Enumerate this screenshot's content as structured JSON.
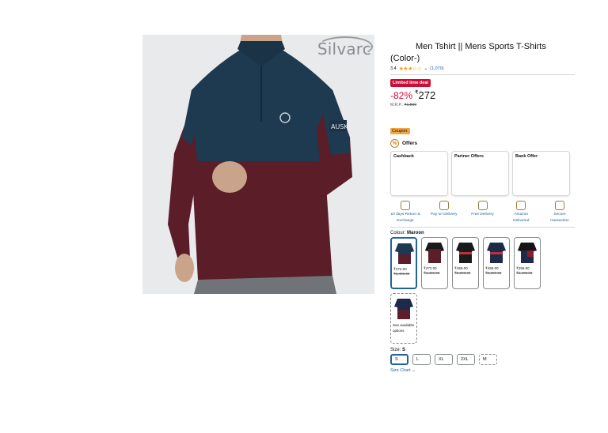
{
  "brand": "Silvarc",
  "title": "Men Tshirt || Mens Sports T-Shirts (Color-)",
  "rating": {
    "value": "3.4",
    "stars": "★★★☆☆",
    "count": "(1,070)"
  },
  "deal_badge": "Limited time deal",
  "price": {
    "discount": "-82%",
    "symbol": "₹",
    "amount": "272",
    "mrp_label": "M.R.P.:",
    "mrp": "₹1,500"
  },
  "coupon": "Coupon:",
  "offers": {
    "label": "Offers",
    "cards": [
      {
        "title": "Cashback"
      },
      {
        "title": "Partner Offers"
      },
      {
        "title": "Bank Offer"
      }
    ]
  },
  "features": [
    {
      "icon": "return-box-icon",
      "label": "10 days Return & Exchange"
    },
    {
      "icon": "cash-icon",
      "label": "Pay on Delivery"
    },
    {
      "icon": "truck-icon",
      "label": "Free Delivery"
    },
    {
      "icon": "delivery-van-icon",
      "label": "Amazon Delivered"
    },
    {
      "icon": "lock-icon",
      "label": "Secure transaction"
    }
  ],
  "colour": {
    "label": "Colour:",
    "selected": "Maroon",
    "swatches": [
      {
        "price": "₹272.00",
        "mrp": "₹1,499.00",
        "top": "#1d3a52",
        "bottom": "#5a1f2a"
      },
      {
        "price": "₹272.00",
        "mrp": "₹1,499.00",
        "top": "#5a1f2a",
        "bottom": "#5a1f2a"
      },
      {
        "price": "₹459.00",
        "mrp": "₹2,999.00",
        "top": "#1a1a1d",
        "bottom": "#2a2a2e"
      },
      {
        "price": "₹459.00",
        "mrp": "₹2,999.00",
        "top": "#1d2a4a",
        "bottom": "#2a3550"
      },
      {
        "price": "₹256.00",
        "mrp": "₹1,499.00",
        "top": "#151518",
        "bottom": "#1d2a4a"
      }
    ],
    "more_text": "See available options"
  },
  "size": {
    "label": "Size:",
    "selected": "S",
    "options": [
      "S",
      "L",
      "XL",
      "2XL",
      "M"
    ]
  },
  "size_chart": "Size Chart"
}
